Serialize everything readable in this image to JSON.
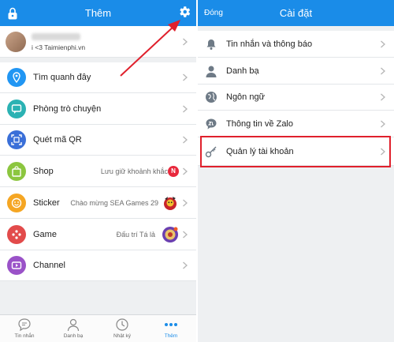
{
  "left_panel": {
    "title": "Thêm",
    "profile": {
      "subtitle": "i <3 Taimienphi.vn"
    },
    "menu": [
      {
        "label": "Tìm quanh đây",
        "icon": "map-pin-icon",
        "color": "#2196f3"
      },
      {
        "label": "Phòng trò chuyện",
        "icon": "chat-room-icon",
        "color": "#2bb2b3"
      },
      {
        "label": "Quét mã QR",
        "icon": "qr-scan-icon",
        "color": "#3a6fd8"
      },
      {
        "label": "Shop",
        "aux": "Lưu giữ khoảnh khắc",
        "badge": "N",
        "icon": "shop-bag-icon",
        "color": "#8cc63f"
      },
      {
        "label": "Sticker",
        "aux": "Chào mừng SEA Games 29",
        "icon": "sticker-smile-icon",
        "color": "#f5a623"
      },
      {
        "label": "Game",
        "aux": "Đấu trí Tá lả",
        "icon": "gamepad-icon",
        "color": "#e24b4b"
      },
      {
        "label": "Channel",
        "icon": "channel-icon",
        "color": "#9a52c8"
      }
    ],
    "tabs": [
      {
        "label": "Tin nhắn",
        "icon": "message-icon"
      },
      {
        "label": "Danh bạ",
        "icon": "contacts-icon"
      },
      {
        "label": "Nhật ký",
        "icon": "clock-icon"
      },
      {
        "label": "Thêm",
        "icon": "more-dots-icon",
        "active": true
      }
    ]
  },
  "right_panel": {
    "title": "Cài đặt",
    "back_label": "Đóng",
    "items": [
      {
        "label": "Tin nhắn và thông báo",
        "icon": "bell-icon"
      },
      {
        "label": "Danh bạ",
        "icon": "person-icon"
      },
      {
        "label": "Ngôn ngữ",
        "icon": "globe-icon"
      },
      {
        "label": "Thông tin về Zalo",
        "icon": "zalo-icon"
      },
      {
        "label": "Quản lý tài khoản",
        "icon": "key-icon",
        "highlighted": true
      }
    ]
  },
  "colors": {
    "primary": "#1a8ce8",
    "highlight": "#e0202c",
    "badge": "#e8283c"
  }
}
